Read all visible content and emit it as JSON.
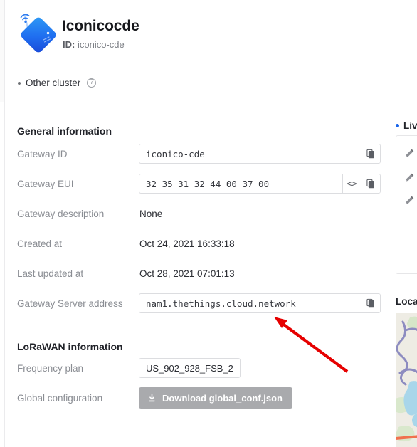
{
  "header": {
    "icon_name": "lorawan-gateway-icon",
    "title": "Iconicocde",
    "id_prefix": "ID:",
    "id_value": "iconico-cde",
    "cluster_label": "Other cluster",
    "cluster_help_icon": "question-mark-circle-icon"
  },
  "general": {
    "section_title": "General information",
    "fields": [
      {
        "label": "Gateway ID",
        "value": "iconico-cde",
        "type": "readonly-input",
        "copy_icon": "copy-icon"
      },
      {
        "label": "Gateway EUI",
        "value": "32 35 31 32 44 00 37 00",
        "type": "readonly-input",
        "code_icon": "angle-brackets-icon",
        "copy_icon": "copy-icon"
      },
      {
        "label": "Gateway description",
        "value": "None",
        "type": "static"
      },
      {
        "label": "Created at",
        "value": "Oct 24, 2021 16:33:18",
        "type": "static"
      },
      {
        "label": "Last updated at",
        "value": "Oct 28, 2021 07:01:13",
        "type": "static"
      },
      {
        "label": "Gateway Server address",
        "value": "nam1.thethings.cloud.network",
        "type": "readonly-input",
        "copy_icon": "copy-icon"
      }
    ]
  },
  "lorawan": {
    "section_title": "LoRaWAN information",
    "frequency_plan_label": "Frequency plan",
    "frequency_plan_value": "US_902_928_FSB_2",
    "global_config_label": "Global configuration",
    "download_button_label": "Download global_conf.json",
    "download_icon": "download-icon"
  },
  "right_panel": {
    "live_data_label": "Liv",
    "live_data_dot_color": "#1a65ea",
    "location_label": "Locat",
    "edit_icon": "pencil-icon",
    "edit_icon_count": 3,
    "map_name": "location-map"
  },
  "annotation": {
    "arrow_color": "#e60000",
    "arrow_name": "red-annotation-arrow"
  }
}
